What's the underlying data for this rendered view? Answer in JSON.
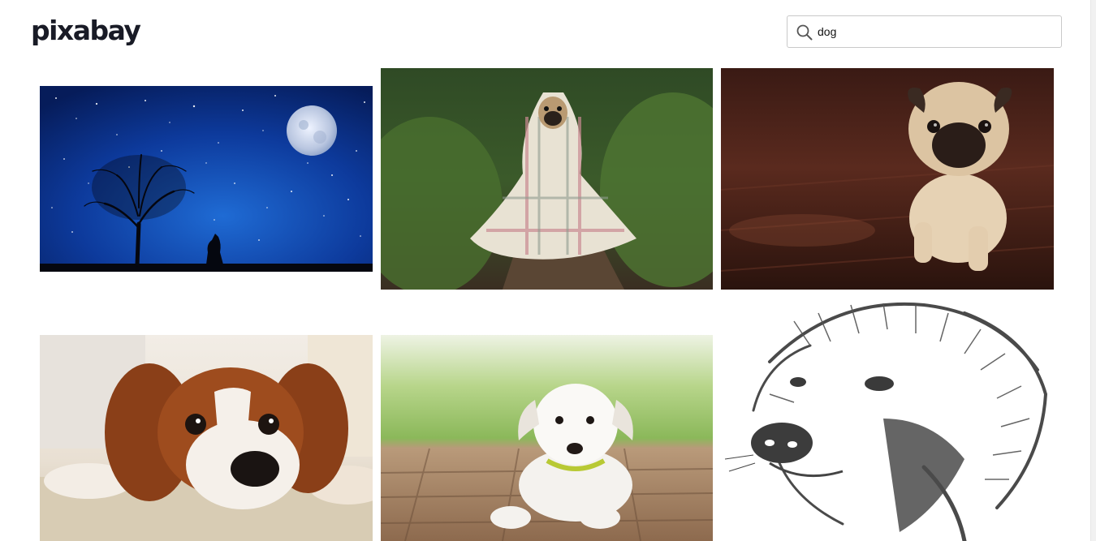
{
  "header": {
    "logo_text": "pixabay",
    "search": {
      "value": "dog",
      "icon": "search-icon"
    }
  },
  "results": [
    {
      "subject": "night-sky-tree-wolf-moon"
    },
    {
      "subject": "pug-wrapped-in-blanket-forest-path"
    },
    {
      "subject": "pug-puppy-on-wooden-floor"
    },
    {
      "subject": "cavalier-spaniel-lying-on-carpet"
    },
    {
      "subject": "white-puppy-on-wooden-deck"
    },
    {
      "subject": "dog-head-ink-drawing"
    }
  ],
  "colors": {
    "logo": "#191b26",
    "search_border": "#c9c9c9",
    "background": "#ffffff"
  }
}
